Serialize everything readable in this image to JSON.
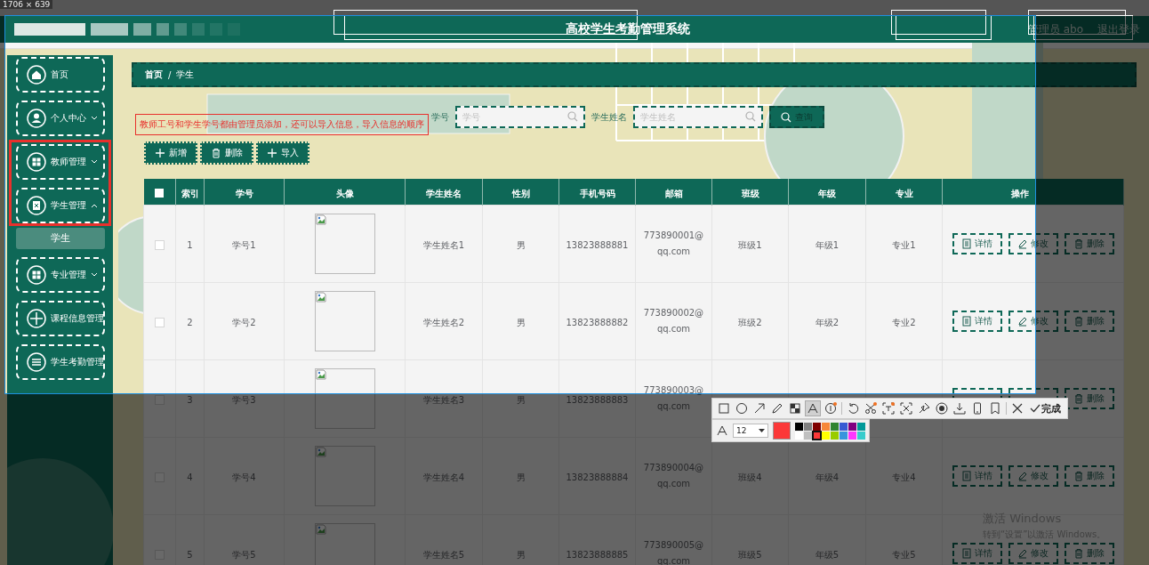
{
  "capture": {
    "size_label": "1706 × 639"
  },
  "header": {
    "title": "高校学生考勤管理系统",
    "user": "管理员 abo",
    "logout": "退出登录"
  },
  "sidebar": {
    "items": [
      {
        "label": "首页",
        "expandable": false
      },
      {
        "label": "个人中心",
        "expandable": true,
        "expanded": false
      },
      {
        "label": "教师管理",
        "expandable": true,
        "expanded": false
      },
      {
        "label": "学生管理",
        "expandable": true,
        "expanded": true,
        "children": [
          {
            "label": "学生",
            "selected": true
          }
        ]
      },
      {
        "label": "专业管理",
        "expandable": true,
        "expanded": false
      },
      {
        "label": "课程信息管理",
        "expandable": false
      },
      {
        "label": "学生考勤管理",
        "expandable": false
      }
    ]
  },
  "breadcrumb": {
    "items": [
      "首页",
      "学生"
    ],
    "separator": "/"
  },
  "search": {
    "fields": [
      {
        "label": "学号",
        "placeholder": "学号"
      },
      {
        "label": "学生姓名",
        "placeholder": "学生姓名"
      }
    ],
    "button": "查询"
  },
  "actions": [
    "新增",
    "删除",
    "导入"
  ],
  "table": {
    "select_all": {
      "checked": false
    },
    "columns": [
      "索引",
      "学号",
      "头像",
      "学生姓名",
      "性别",
      "手机号码",
      "邮箱",
      "班级",
      "年级",
      "专业",
      "操作"
    ],
    "rows": [
      {
        "checked": false,
        "cells": [
          "1",
          "学号1",
          "",
          "学生姓名1",
          "男",
          "13823888881",
          "773890001@qq.com",
          "班级1",
          "年级1",
          "专业1"
        ],
        "actions": [
          "详情",
          "修改",
          "删除"
        ]
      },
      {
        "checked": false,
        "cells": [
          "2",
          "学号2",
          "",
          "学生姓名2",
          "男",
          "13823888882",
          "773890002@qq.com",
          "班级2",
          "年级2",
          "专业2"
        ],
        "actions": [
          "详情",
          "修改",
          "删除"
        ]
      },
      {
        "checked": false,
        "cells": [
          "3",
          "学号3",
          "",
          "学生姓名3",
          "男",
          "13823888883",
          "773890003@qq.com"
        ],
        "actions": [
          "删除"
        ]
      },
      {
        "checked": false,
        "cells": [
          "4",
          "学号4",
          "",
          "学生姓名4",
          "男",
          "13823888884",
          "773890004@qq.com",
          "班级4",
          "年级4",
          "专业4"
        ],
        "actions": [
          "详情",
          "修改",
          "删除"
        ]
      },
      {
        "checked": false,
        "cells": [
          "5",
          "学号5",
          "",
          "学生姓名5",
          "男",
          "13823888885",
          "773890005@qq.com",
          "班级5",
          "年级5",
          "专业5"
        ],
        "actions": [
          "详情",
          "修改",
          "删除"
        ]
      }
    ]
  },
  "annotations": [
    {
      "kind": "rect",
      "color": "#ffffff"
    },
    {
      "kind": "rect",
      "color": "#ffffff"
    },
    {
      "kind": "rect",
      "color": "#ffffff"
    },
    {
      "kind": "rect",
      "color": "#ffffff"
    },
    {
      "kind": "rect",
      "color": "#ffffff"
    },
    {
      "kind": "rect",
      "color": "#ffffff"
    },
    {
      "kind": "rect",
      "color": "#e8302c"
    },
    {
      "kind": "text",
      "color": "#e8302c",
      "text": "教师工号和学生学号都由管理员添加，还可以导入信息，导入信息的顺序"
    }
  ],
  "toolbar": {
    "tools": [
      {
        "kind": "rect",
        "selected": false
      },
      {
        "kind": "ellipse",
        "selected": false
      },
      {
        "kind": "arrow",
        "selected": false
      },
      {
        "kind": "pen",
        "selected": false
      },
      {
        "kind": "mosaic",
        "selected": false
      },
      {
        "kind": "text",
        "selected": true
      },
      {
        "kind": "serial",
        "selected": false
      },
      {
        "kind": "undo",
        "selected": false
      },
      {
        "kind": "cut",
        "selected": false
      },
      {
        "kind": "ocr",
        "selected": false
      },
      {
        "kind": "scroll",
        "selected": false
      },
      {
        "kind": "pin",
        "selected": false
      },
      {
        "kind": "record",
        "selected": false
      },
      {
        "kind": "save",
        "selected": false
      },
      {
        "kind": "phone",
        "selected": false
      },
      {
        "kind": "bookmark",
        "selected": false
      },
      {
        "kind": "close",
        "selected": false
      }
    ],
    "done": "完成",
    "font_size": "12",
    "palette": [
      {
        "color": "#000000",
        "selected": false
      },
      {
        "color": "#808080",
        "selected": false
      },
      {
        "color": "#800000",
        "selected": false
      },
      {
        "color": "#f7883a",
        "selected": false
      },
      {
        "color": "#308430",
        "selected": false
      },
      {
        "color": "#385ad3",
        "selected": false
      },
      {
        "color": "#800080",
        "selected": false
      },
      {
        "color": "#009999",
        "selected": false
      },
      {
        "color": "#ffffff",
        "selected": false
      },
      {
        "color": "#c0c0c0",
        "selected": false
      },
      {
        "color": "#fb3838",
        "selected": true
      },
      {
        "color": "#ffff00",
        "selected": false
      },
      {
        "color": "#99cc00",
        "selected": false
      },
      {
        "color": "#3895dd",
        "selected": false
      },
      {
        "color": "#ff38ff",
        "selected": false
      },
      {
        "color": "#38cccc",
        "selected": false
      }
    ]
  },
  "windows_notice": [
    "激活 Windows",
    "转到“设置”以激活 Windows。"
  ]
}
